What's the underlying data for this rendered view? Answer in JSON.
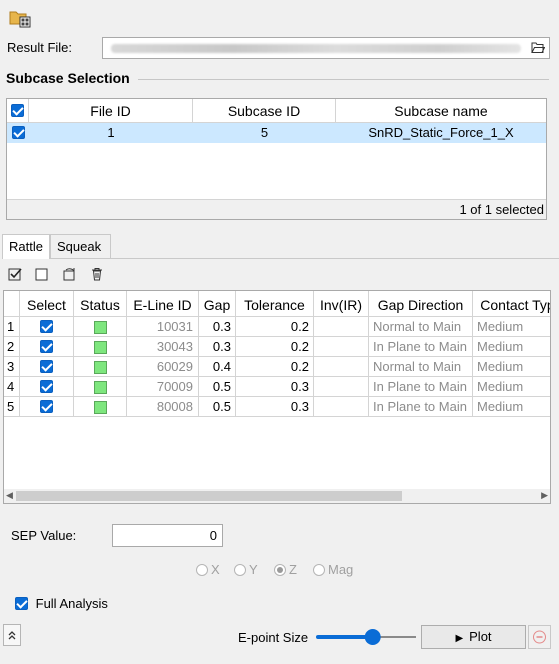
{
  "result_file": {
    "label": "Result File:"
  },
  "subcase": {
    "title": "Subcase Selection",
    "columns": [
      "File ID",
      "Subcase ID",
      "Subcase name"
    ],
    "rows": [
      {
        "file_id": "1",
        "subcase_id": "5",
        "name": "SnRD_Static_Force_1_X"
      }
    ],
    "count_text": "1 of 1 selected"
  },
  "tabs": [
    "Rattle",
    "Squeak"
  ],
  "contact_table": {
    "columns": [
      "Select",
      "Status",
      "E-Line ID",
      "Gap",
      "Tolerance",
      "Inv(IR)",
      "Gap Direction",
      "Contact Typ"
    ],
    "rows": [
      {
        "n": "1",
        "eline": "10031",
        "gap": "0.3",
        "tol": "0.2",
        "inv": "",
        "dir": "Normal to Main",
        "type": "Medium"
      },
      {
        "n": "2",
        "eline": "30043",
        "gap": "0.3",
        "tol": "0.2",
        "inv": "",
        "dir": "In Plane to Main",
        "type": "Medium"
      },
      {
        "n": "3",
        "eline": "60029",
        "gap": "0.4",
        "tol": "0.2",
        "inv": "",
        "dir": "Normal to Main",
        "type": "Medium"
      },
      {
        "n": "4",
        "eline": "70009",
        "gap": "0.5",
        "tol": "0.3",
        "inv": "",
        "dir": "In Plane to Main",
        "type": "Medium"
      },
      {
        "n": "5",
        "eline": "80008",
        "gap": "0.5",
        "tol": "0.3",
        "inv": "",
        "dir": "In Plane to Main",
        "type": "Medium"
      }
    ]
  },
  "sep": {
    "label": "SEP Value:",
    "value": "0"
  },
  "axis_options": {
    "x": "X",
    "y": "Y",
    "z": "Z",
    "mag": "Mag",
    "selected": "Z"
  },
  "full_analysis": {
    "label": "Full Analysis",
    "checked": true
  },
  "epoint": {
    "label": "E-point Size",
    "level": 0.58
  },
  "plot": {
    "label": "Plot"
  },
  "colors": {
    "accent": "#0a6cd6",
    "selection": "#cce8ff",
    "status_ok": "#7ee67e"
  },
  "icons": [
    "open-result-icon",
    "folder-icon",
    "select-all-icon",
    "deselect-all-icon",
    "refresh-icon",
    "delete-icon",
    "collapse-icon",
    "play-icon",
    "remove-icon"
  ]
}
